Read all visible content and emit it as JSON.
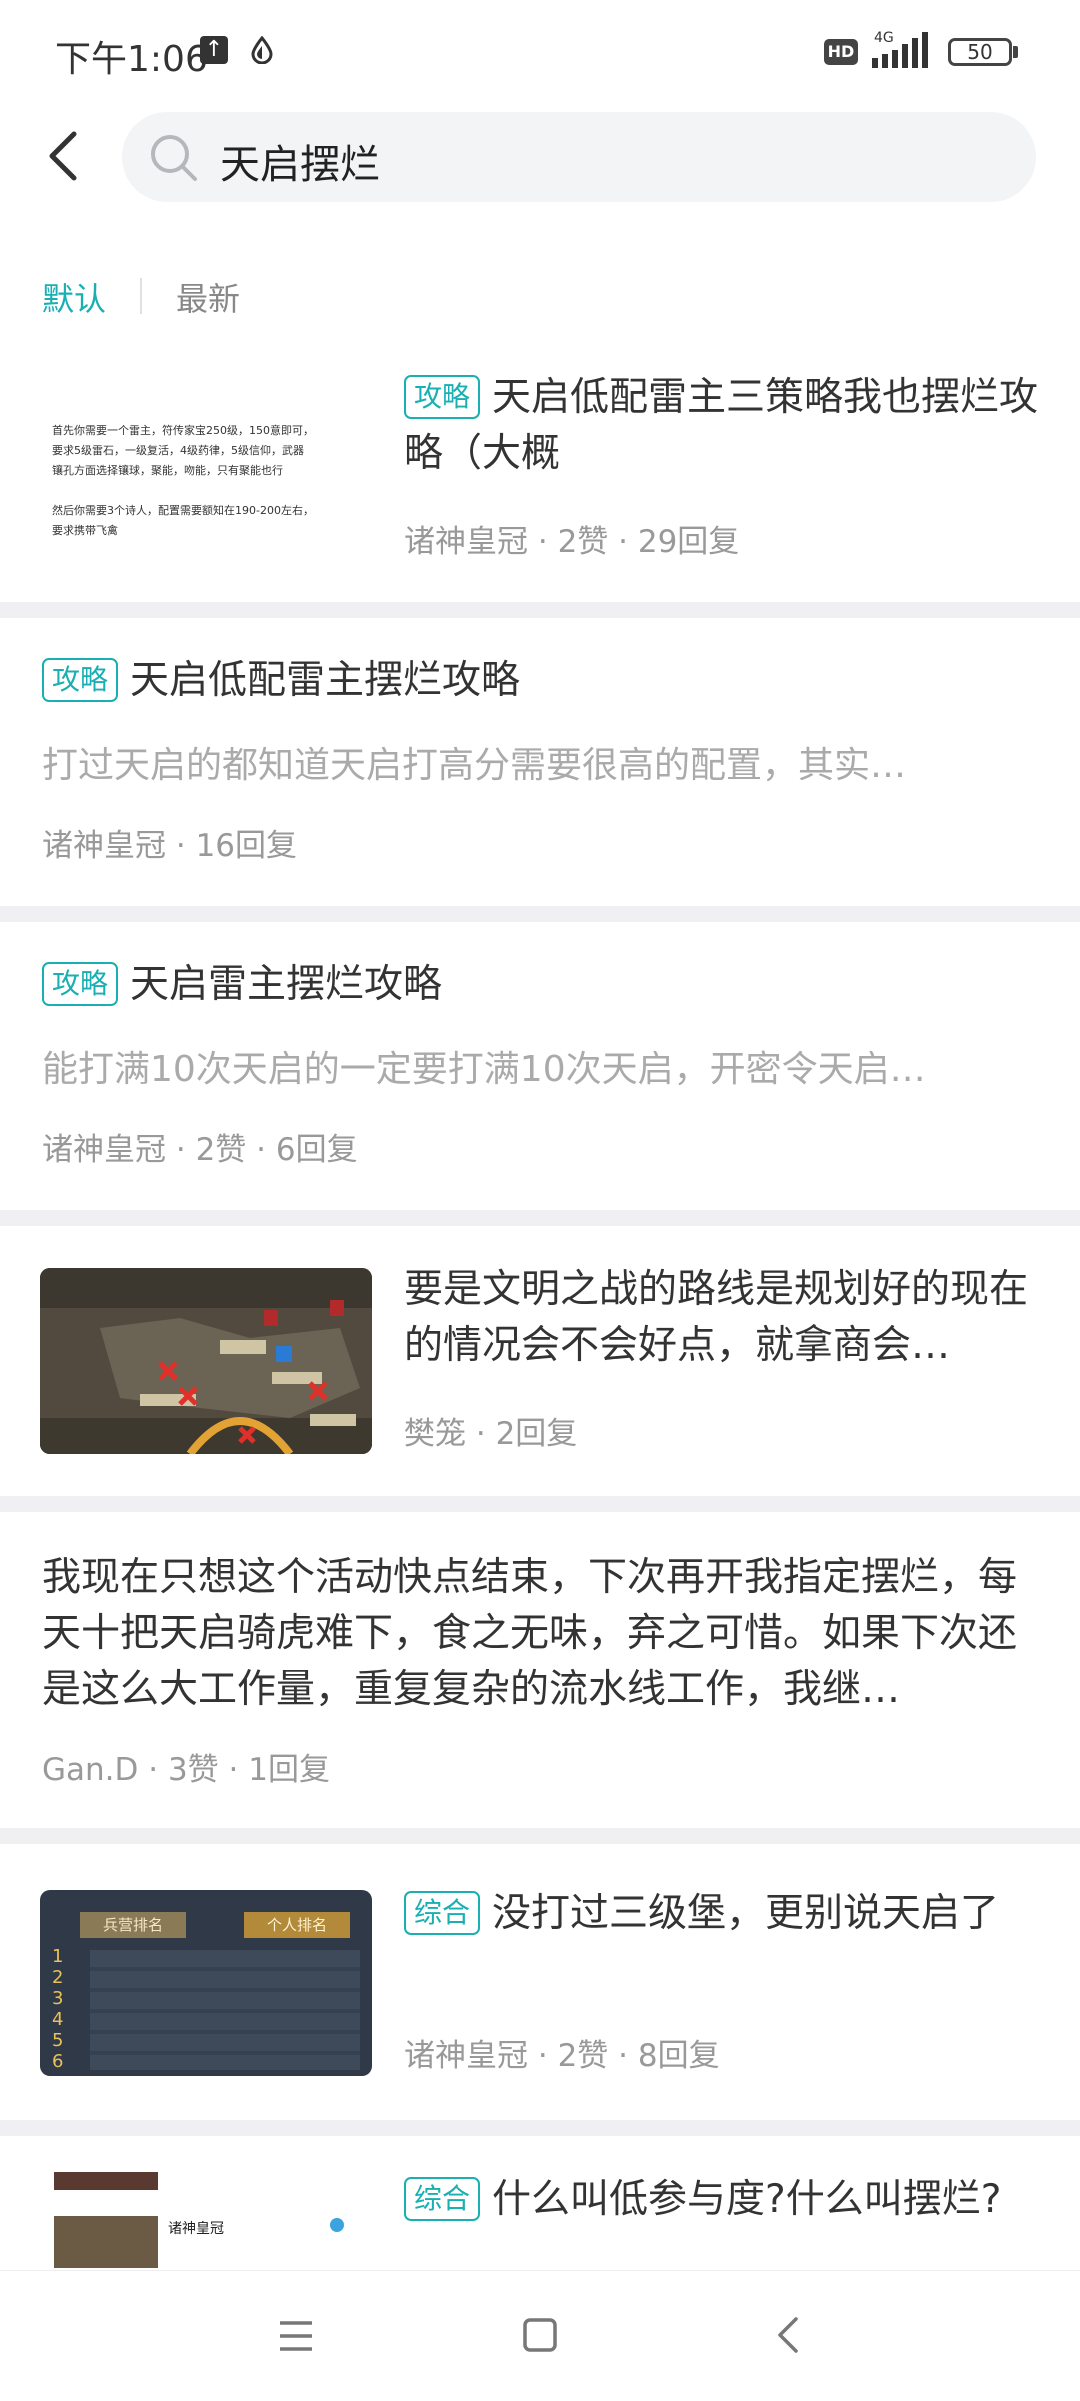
{
  "status_bar": {
    "time": "下午1:06",
    "network": "4G",
    "battery": "50",
    "hd": "HD"
  },
  "search": {
    "query": "天启摆烂"
  },
  "tabs": [
    {
      "label": "默认",
      "active": true
    },
    {
      "label": "最新",
      "active": false
    }
  ],
  "posts": [
    {
      "thumb_text": [
        "首先你需要一个雷主，符传家宝250级，150意即可，",
        "要求5级雷石，一级复活，4级药律，5级信仰，武器",
        "镶孔方面选择镶球，聚能，吻能，只有聚能也行",
        "",
        "然后你需要3个诗人，配置需要额知在190-200左右，",
        "要求携带飞禽"
      ],
      "tag": "攻略",
      "title": "天启低配雷主三策略我也摆烂攻略（大概",
      "author": "诸神皇冠",
      "likes": "2赞",
      "replies": "29回复"
    },
    {
      "tag": "攻略",
      "title": "天启低配雷主摆烂攻略",
      "excerpt": "打过天启的都知道天启打高分需要很高的配置，其实…",
      "author": "诸神皇冠",
      "replies": "16回复"
    },
    {
      "tag": "攻略",
      "title": "天启雷主摆烂攻略",
      "excerpt": "能打满10次天启的一定要打满10次天启，开密令天启…",
      "author": "诸神皇冠",
      "likes": "2赞",
      "replies": "6回复"
    },
    {
      "title": "要是文明之战的路线是规划好的现在的情况会不会好点，就拿商会…",
      "author": "樊笼",
      "replies": "2回复"
    },
    {
      "title": "我现在只想这个活动快点结束，下次再开我指定摆烂，每天十把天启骑虎难下，食之无味，弃之可惜。如果下次还是这么大工作量，重复复杂的流水线工作，我继…",
      "author": "Gan.D",
      "likes": "3赞",
      "replies": "1回复"
    },
    {
      "tag": "综合",
      "title": "没打过三级堡，更别说天启了",
      "author": "诸神皇冠",
      "likes": "2赞",
      "replies": "8回复",
      "thumb_headers": [
        "兵营排名",
        "个人排名"
      ],
      "thumb_ranks": [
        "1",
        "2",
        "3",
        "4",
        "5",
        "6"
      ]
    },
    {
      "tag": "综合",
      "title": "什么叫低参与度?什么叫摆烂?",
      "thumb_name": "诸神皇冠"
    }
  ],
  "colors": {
    "accent": "#1aafb3",
    "separator": "#f0f0f2",
    "meta_text": "#999999"
  }
}
